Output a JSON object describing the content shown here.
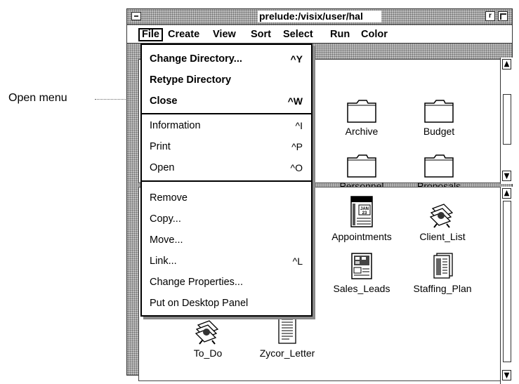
{
  "annotation": {
    "callout_text": "Open menu"
  },
  "window": {
    "title": "prelude:/visix/user/hal",
    "sysmenu_icon": "sysmenu-bar-icon",
    "minimize_glyph": "r"
  },
  "menubar": {
    "items": [
      {
        "label": "File",
        "active": true
      },
      {
        "label": "Create"
      },
      {
        "label": "View"
      },
      {
        "label": "Sort"
      },
      {
        "label": "Select"
      },
      {
        "label": "Run"
      },
      {
        "label": "Color"
      }
    ]
  },
  "file_menu": {
    "items": [
      {
        "label": "Change Directory...",
        "shortcut": "^Y"
      },
      {
        "label": "Retype Directory",
        "shortcut": ""
      },
      {
        "label": "Close",
        "shortcut": "^W"
      },
      {
        "label": "Information",
        "shortcut": "^I"
      },
      {
        "label": "Print",
        "shortcut": "^P"
      },
      {
        "label": "Open",
        "shortcut": "^O"
      },
      {
        "label": "Remove",
        "shortcut": ""
      },
      {
        "label": "Copy...",
        "shortcut": ""
      },
      {
        "label": "Move...",
        "shortcut": ""
      },
      {
        "label": "Link...",
        "shortcut": "^L"
      },
      {
        "label": "Change Properties...",
        "shortcut": ""
      },
      {
        "label": "Put on Desktop Panel",
        "shortcut": ""
      }
    ]
  },
  "folders": [
    {
      "label": "Archive",
      "icon": "folder-icon"
    },
    {
      "label": "Budget",
      "icon": "folder-icon"
    },
    {
      "label": "Personnel",
      "icon": "folder-icon"
    },
    {
      "label": "Proposals",
      "icon": "folder-icon"
    }
  ],
  "files": [
    {
      "label": "Appointments",
      "icon": "calendar-icon"
    },
    {
      "label": "Client_List",
      "icon": "rolodex-icon"
    },
    {
      "label": "Sales_Leads",
      "icon": "spreadsheet-icon"
    },
    {
      "label": "Staffing_Plan",
      "icon": "document-stack-icon"
    },
    {
      "label": "To_Do",
      "icon": "rolodex-icon"
    },
    {
      "label": "Zycor_Letter",
      "icon": "text-document-icon"
    }
  ]
}
